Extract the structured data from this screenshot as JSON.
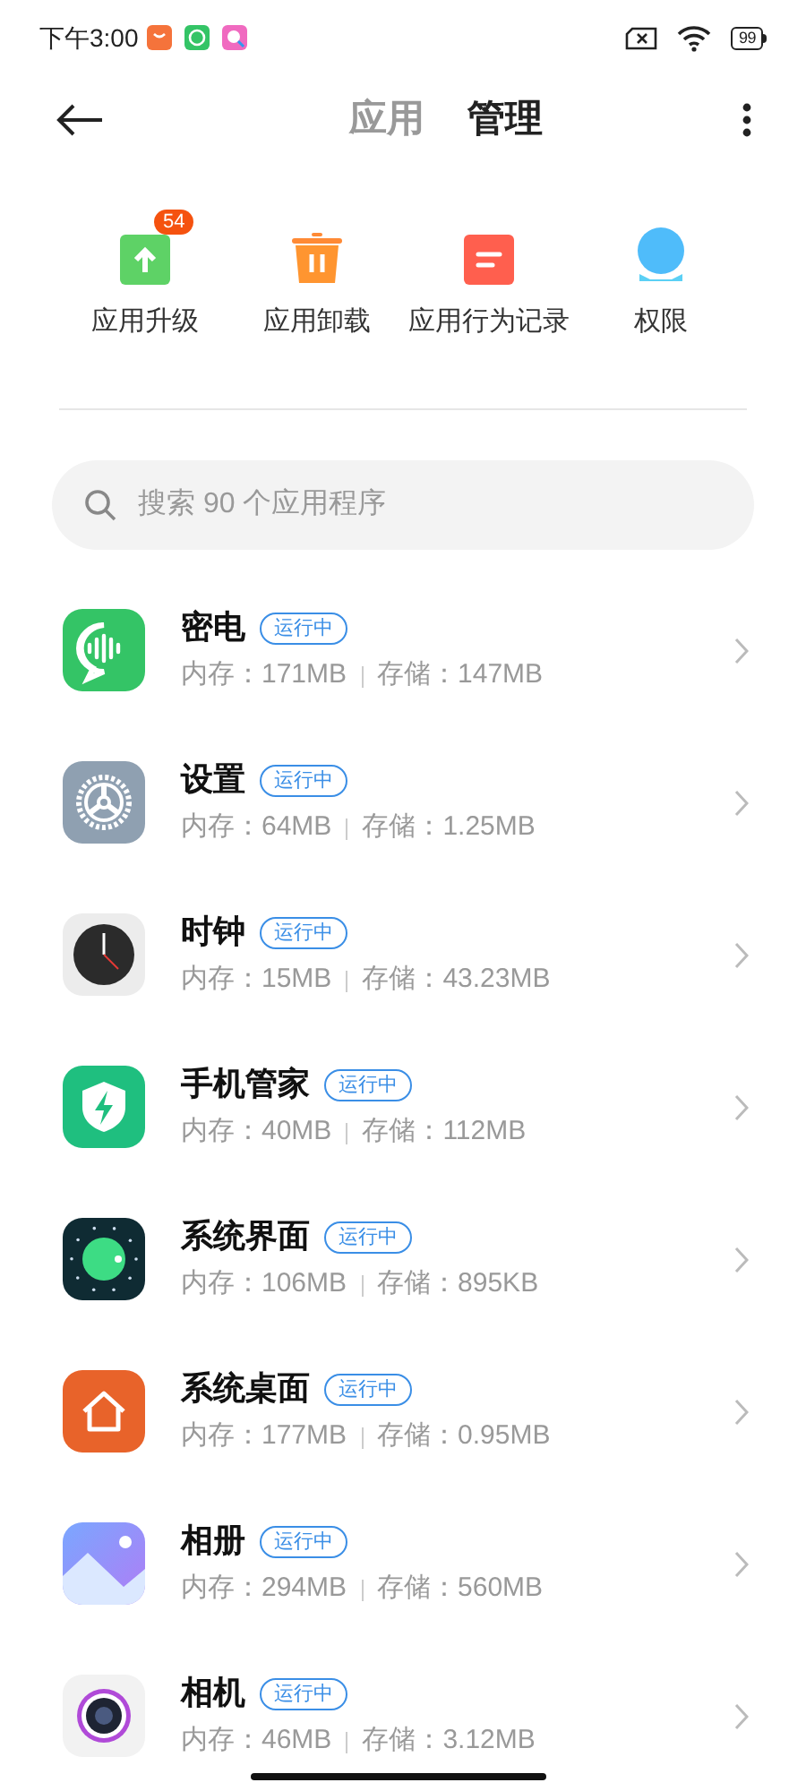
{
  "status_bar": {
    "time": "下午3:00",
    "battery": "99"
  },
  "header": {
    "tabs": [
      {
        "label": "应用",
        "selected": false
      },
      {
        "label": "管理",
        "selected": true
      }
    ]
  },
  "shortcuts": [
    {
      "label": "应用升级",
      "badge": "54"
    },
    {
      "label": "应用卸载"
    },
    {
      "label": "应用行为记录"
    },
    {
      "label": "权限"
    }
  ],
  "search": {
    "placeholder": "搜索 90 个应用程序"
  },
  "apps": [
    {
      "name": "密电",
      "status": "运行中",
      "memory": "内存：171MB",
      "storage": "存储：147MB"
    },
    {
      "name": "设置",
      "status": "运行中",
      "memory": "内存：64MB",
      "storage": "存储：1.25MB"
    },
    {
      "name": "时钟",
      "status": "运行中",
      "memory": "内存：15MB",
      "storage": "存储：43.23MB"
    },
    {
      "name": "手机管家",
      "status": "运行中",
      "memory": "内存：40MB",
      "storage": "存储：112MB"
    },
    {
      "name": "系统界面",
      "status": "运行中",
      "memory": "内存：106MB",
      "storage": "存储：895KB"
    },
    {
      "name": "系统桌面",
      "status": "运行中",
      "memory": "内存：177MB",
      "storage": "存储：0.95MB"
    },
    {
      "name": "相册",
      "status": "运行中",
      "memory": "内存：294MB",
      "storage": "存储：560MB"
    },
    {
      "name": "相机",
      "status": "运行中",
      "memory": "内存：46MB",
      "storage": "存储：3.12MB"
    }
  ]
}
